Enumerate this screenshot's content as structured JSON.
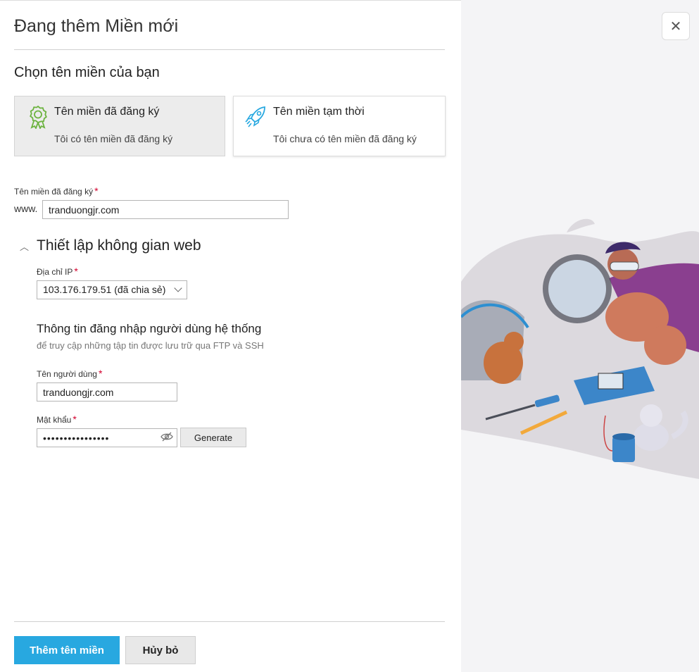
{
  "dialog": {
    "title": "Đang thêm Miền mới",
    "close_icon": "close-icon"
  },
  "domain_choice": {
    "heading": "Chọn tên miền của bạn",
    "options": [
      {
        "name": "Tên miền đã đăng ký",
        "description": "Tôi có tên miền đã đăng ký",
        "icon": "award-badge-icon",
        "selected": true
      },
      {
        "name": "Tên miền tạm thời",
        "description": "Tôi chưa có tên miền đã đăng ký",
        "icon": "rocket-icon",
        "selected": false
      }
    ]
  },
  "registered_domain": {
    "label": "Tên miền đã đăng ký",
    "required_mark": "*",
    "prefix": "www.",
    "value": "tranduongjr.com"
  },
  "webspace": {
    "heading": "Thiết lập không gian web",
    "ip": {
      "label": "Địa chỉ IP",
      "required_mark": "*",
      "selected": "103.176.179.51 (đã chia sẻ)"
    },
    "login": {
      "heading": "Thông tin đăng nhập người dùng hệ thống",
      "subheading": "để truy cập những tập tin được lưu trữ qua FTP và SSH",
      "username_label": "Tên người dùng",
      "username_value": "tranduongjr.com",
      "password_label": "Mật khẩu",
      "password_value": "••••••••••••••••",
      "required_mark": "*",
      "generate_label": "Generate"
    }
  },
  "footer": {
    "submit_label": "Thêm tên miền",
    "cancel_label": "Hủy bỏ"
  },
  "colors": {
    "primary": "#28a8e0",
    "required": "#d3002d",
    "award_icon": "#6cb33f",
    "rocket_icon": "#28a8e0"
  }
}
